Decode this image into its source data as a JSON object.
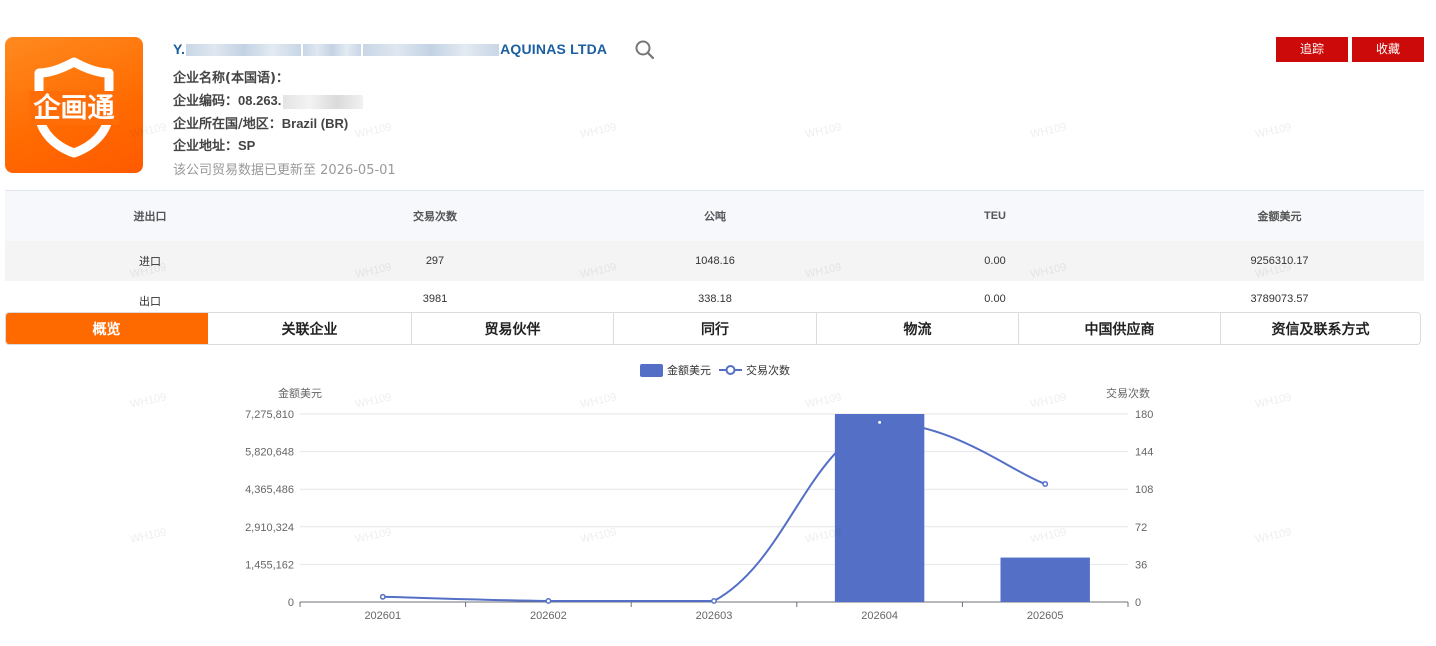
{
  "company": {
    "name_prefix": "Y.",
    "name_suffix": "AQUINAS LTDA",
    "local_name_label": "企业名称(本国语)：",
    "code_label": "企业编码：",
    "code_value": "08.263.",
    "country_label": "企业所在国/地区：",
    "country_value": "Brazil (BR)",
    "address_label": "企业地址：",
    "address_value": "SP",
    "update_text": "该公司贸易数据已更新至",
    "update_date": "2026-05-01"
  },
  "logo": {
    "text": "企画通"
  },
  "actions": {
    "track": "追踪",
    "favorite": "收藏"
  },
  "stats": {
    "headers": [
      "进出口",
      "交易次数",
      "公吨",
      "TEU",
      "金额美元"
    ],
    "rows": [
      [
        "进口",
        "297",
        "1048.16",
        "0.00",
        "9256310.17"
      ],
      [
        "出口",
        "3981",
        "338.18",
        "0.00",
        "3789073.57"
      ]
    ]
  },
  "tabs": [
    "概览",
    "关联企业",
    "贸易伙伴",
    "同行",
    "物流",
    "中国供应商",
    "资信及联系方式"
  ],
  "watermark": "WH109",
  "chart_data": {
    "type": "bar",
    "legend": [
      "金额美元",
      "交易次数"
    ],
    "left_axis_label": "金额美元",
    "right_axis_label": "交易次数",
    "categories": [
      "202601",
      "202602",
      "202603",
      "202604",
      "202605"
    ],
    "series": [
      {
        "name": "金额美元",
        "type": "bar",
        "values": [
          0,
          0,
          0,
          7275810,
          1720000
        ],
        "color": "#5470c6"
      },
      {
        "name": "交易次数",
        "type": "line",
        "values": [
          5,
          1,
          1,
          172,
          113
        ],
        "color": "#5470c6"
      }
    ],
    "ylim_left": [
      0,
      7275810
    ],
    "ylim_right": [
      0,
      180
    ],
    "left_ticks": [
      "0",
      "1,455,162",
      "2,910,324",
      "4,365,486",
      "5,820,648",
      "7,275,810"
    ],
    "right_ticks": [
      "0",
      "36",
      "72",
      "108",
      "144",
      "180"
    ]
  }
}
